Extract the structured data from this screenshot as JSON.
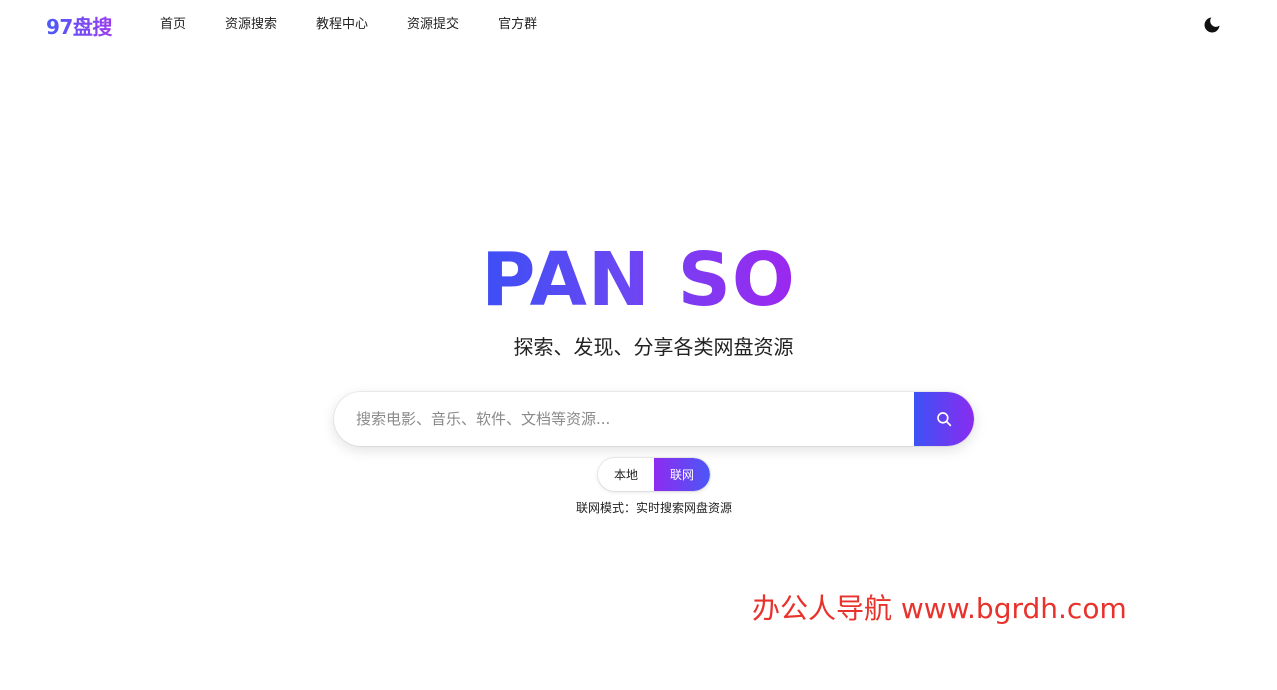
{
  "header": {
    "brand": "97盘搜",
    "nav": [
      "首页",
      "资源搜索",
      "教程中心",
      "资源提交",
      "官方群"
    ],
    "theme_icon": "moon-icon"
  },
  "hero": {
    "title": "PAN SO",
    "subtitle": "探索、发现、分享各类网盘资源"
  },
  "search": {
    "value": "",
    "placeholder": "搜索电影、音乐、软件、文档等资源...",
    "button_icon": "search-icon"
  },
  "mode": {
    "options": [
      "本地",
      "联网"
    ],
    "selected": "联网",
    "description": "联网模式：实时搜索网盘资源"
  },
  "watermark": "办公人导航 www.bgrdh.com",
  "colors": {
    "gradient_start": "#3d4ff5",
    "gradient_end": "#9d27ef",
    "watermark": "#e8322b"
  }
}
